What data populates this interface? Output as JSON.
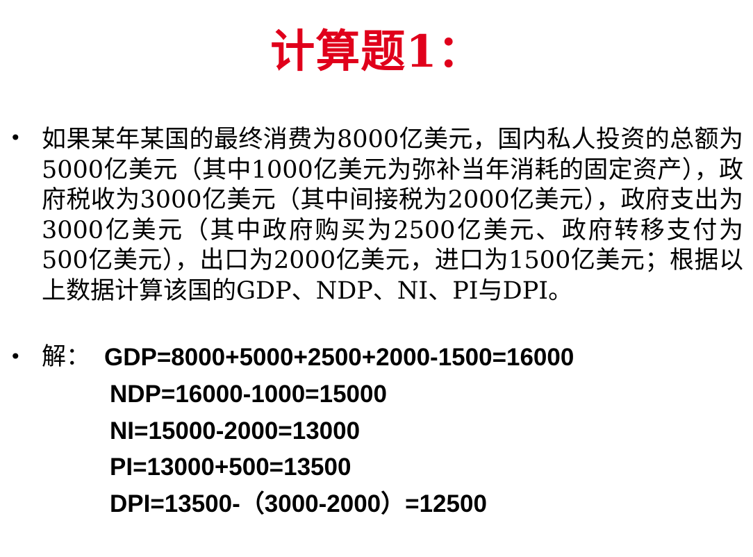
{
  "slide": {
    "title": "计算题1：",
    "bullets": [
      "•",
      "•"
    ],
    "problem_text": "如果某年某国的最终消费为8000亿美元，国内私人投资的总额为5000亿美元（其中1000亿美元为弥补当年消耗的固定资产），政府税收为3000亿美元（其中间接税为2000亿美元），政府支出为3000亿美元（其中政府购买为2500亿美元、政府转移支付为500亿美元），出口为2000亿美元，进口为1500亿美元；根据以上数据计算该国的GDP、NDP、NI、PI与DPI。",
    "answer_label": "解：",
    "equations": [
      "GDP=8000+5000+2500+2000-1500=16000",
      "NDP=16000-1000=15000",
      "NI=15000-2000=13000",
      "PI=13000+500=13500",
      "DPI=13500-（3000-2000）=12500"
    ],
    "colors": {
      "title": "#e0001b",
      "text": "#000000",
      "background": "#ffffff"
    }
  }
}
